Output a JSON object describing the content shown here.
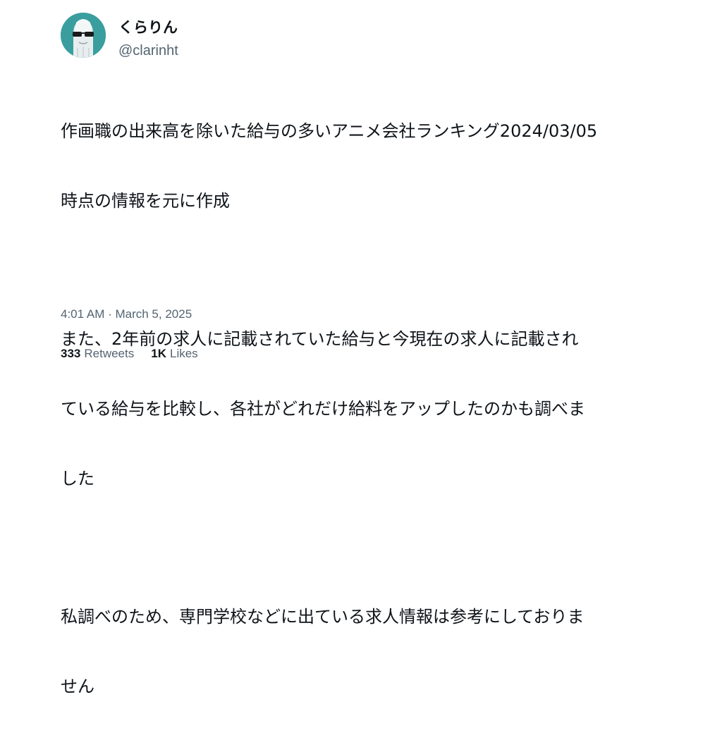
{
  "author": {
    "display_name": "くらりん",
    "handle": "@clarinht"
  },
  "tweet": {
    "paragraphs": [
      "作画職の出来高を除いた給与の多いアニメ会社ランキング2024/03/05時点の情報を元に作成",
      "また、2年前の求人に記載されていた給与と今現在の求人に記載されている給与を比較し、各社がどれだけ給料をアップしたのかも調べました",
      "私調べのため、専門学校などに出ている求人情報は参考にしておりません"
    ],
    "line_1": "作画職の出来高を除いた給与の多いアニメ会社ランキング2024/03/05",
    "line_2": "時点の情報を元に作成",
    "line_3": "また、2年前の求人に記載されていた給与と今現在の求人に記載され",
    "line_4": "ている給与を比較し、各社がどれだけ給料をアップしたのかも調べま",
    "line_5": "した",
    "line_6": "私調べのため、専門学校などに出ている求人情報は参考にしておりま",
    "line_7": "せん",
    "timestamp": "4:01 AM · March 5, 2025"
  },
  "stats": {
    "retweets_count": "333",
    "retweets_label": "Retweets",
    "likes_count": "1K",
    "likes_label": "Likes"
  },
  "colors": {
    "text": "#0f1419",
    "secondary": "#536471",
    "avatar_bg": "#3a9e9e"
  },
  "icons": {
    "avatar": "avatar-character-with-sunglasses"
  }
}
